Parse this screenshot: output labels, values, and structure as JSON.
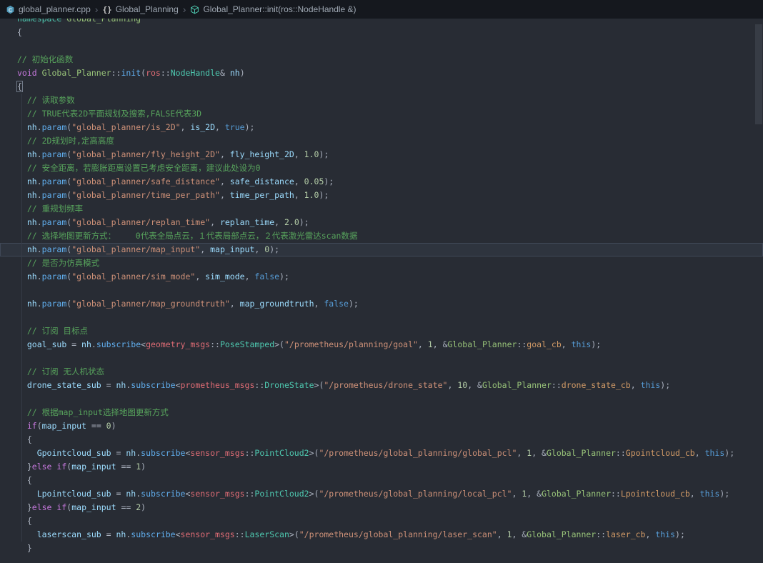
{
  "breadcrumb": {
    "separator": "›",
    "file": "global_planner.cpp",
    "namespace_icon": "{}",
    "namespace": "Global_Planning",
    "symbol": "Global_Planner::init(ros::NodeHandle &)"
  },
  "palette": {
    "editor_background": "#282c34",
    "breadcrumb_background": "#15181e",
    "foreground": "#abb2bf",
    "comment": "#57a35c",
    "keyword": "#c678dd",
    "boolean_this": "#569cd6",
    "function": "#61afef",
    "string": "#ce9178",
    "type": "#4ec9b0",
    "namespace_token": "#e06c75",
    "class_token": "#98c379",
    "number": "#b5cea8",
    "member_callback": "#d19a66",
    "variable": "#9cdcfe"
  },
  "editor": {
    "lines": [
      {
        "t": [
          [
            "ty",
            "namespace"
          ],
          [
            "pl",
            " "
          ],
          [
            "cls",
            "Global_Planning"
          ]
        ]
      },
      {
        "t": [
          [
            "pl",
            "{"
          ]
        ]
      },
      {
        "t": []
      },
      {
        "t": [
          [
            "cm",
            "// 初始化函数"
          ]
        ]
      },
      {
        "t": [
          [
            "kw",
            "void"
          ],
          [
            "pl",
            " "
          ],
          [
            "cls",
            "Global_Planner"
          ],
          [
            "pl",
            "::"
          ],
          [
            "fn",
            "init"
          ],
          [
            "pl",
            "("
          ],
          [
            "ns",
            "ros"
          ],
          [
            "pl",
            "::"
          ],
          [
            "ty",
            "NodeHandle"
          ],
          [
            "pl",
            "& "
          ],
          [
            "id",
            "nh"
          ],
          [
            "pl",
            ")"
          ]
        ]
      },
      {
        "t": [
          [
            "brkt",
            "{"
          ]
        ]
      },
      {
        "t": [
          [
            "cm",
            "  // 读取参数"
          ]
        ]
      },
      {
        "t": [
          [
            "cm",
            "  // TRUE代表2D平面规划及搜索,FALSE代表3D"
          ]
        ]
      },
      {
        "t": [
          [
            "pl",
            "  "
          ],
          [
            "id",
            "nh"
          ],
          [
            "pl",
            "."
          ],
          [
            "fn",
            "param"
          ],
          [
            "pl",
            "("
          ],
          [
            "str",
            "\"global_planner/is_2D\""
          ],
          [
            "pl",
            ", "
          ],
          [
            "id",
            "is_2D"
          ],
          [
            "pl",
            ", "
          ],
          [
            "kw2",
            "true"
          ],
          [
            "pl",
            ");"
          ]
        ]
      },
      {
        "t": [
          [
            "cm",
            "  // 2D规划时,定高高度"
          ]
        ]
      },
      {
        "t": [
          [
            "pl",
            "  "
          ],
          [
            "id",
            "nh"
          ],
          [
            "pl",
            "."
          ],
          [
            "fn",
            "param"
          ],
          [
            "pl",
            "("
          ],
          [
            "str",
            "\"global_planner/fly_height_2D\""
          ],
          [
            "pl",
            ", "
          ],
          [
            "id",
            "fly_height_2D"
          ],
          [
            "pl",
            ", "
          ],
          [
            "num",
            "1.0"
          ],
          [
            "pl",
            ");"
          ]
        ]
      },
      {
        "t": [
          [
            "cm",
            "  // 安全距离，若膨胀距离设置已考虑安全距离，建议此处设为0"
          ]
        ]
      },
      {
        "t": [
          [
            "pl",
            "  "
          ],
          [
            "id",
            "nh"
          ],
          [
            "pl",
            "."
          ],
          [
            "fn",
            "param"
          ],
          [
            "pl",
            "("
          ],
          [
            "str",
            "\"global_planner/safe_distance\""
          ],
          [
            "pl",
            ", "
          ],
          [
            "id",
            "safe_distance"
          ],
          [
            "pl",
            ", "
          ],
          [
            "num",
            "0.05"
          ],
          [
            "pl",
            ");"
          ]
        ]
      },
      {
        "t": [
          [
            "pl",
            "  "
          ],
          [
            "id",
            "nh"
          ],
          [
            "pl",
            "."
          ],
          [
            "fn",
            "param"
          ],
          [
            "pl",
            "("
          ],
          [
            "str",
            "\"global_planner/time_per_path\""
          ],
          [
            "pl",
            ", "
          ],
          [
            "id",
            "time_per_path"
          ],
          [
            "pl",
            ", "
          ],
          [
            "num",
            "1.0"
          ],
          [
            "pl",
            ");"
          ]
        ]
      },
      {
        "t": [
          [
            "cm",
            "  // 重规划频率"
          ]
        ]
      },
      {
        "t": [
          [
            "pl",
            "  "
          ],
          [
            "id",
            "nh"
          ],
          [
            "pl",
            "."
          ],
          [
            "fn",
            "param"
          ],
          [
            "pl",
            "("
          ],
          [
            "str",
            "\"global_planner/replan_time\""
          ],
          [
            "pl",
            ", "
          ],
          [
            "id",
            "replan_time"
          ],
          [
            "pl",
            ", "
          ],
          [
            "num",
            "2.0"
          ],
          [
            "pl",
            ");"
          ]
        ]
      },
      {
        "t": [
          [
            "cm",
            "  // 选择地图更新方式：    0代表全局点云，１代表局部点云，２代表激光雷达scan数据"
          ]
        ]
      },
      {
        "hl": true,
        "t": [
          [
            "pl",
            "  "
          ],
          [
            "id",
            "nh"
          ],
          [
            "pl",
            "."
          ],
          [
            "fn",
            "param"
          ],
          [
            "pl",
            "("
          ],
          [
            "str",
            "\"global_planner/map_input\""
          ],
          [
            "pl",
            ", "
          ],
          [
            "id",
            "map_input"
          ],
          [
            "pl",
            ", "
          ],
          [
            "num",
            "0"
          ],
          [
            "pl",
            ");"
          ]
        ]
      },
      {
        "t": [
          [
            "cm",
            "  // 是否为仿真模式"
          ]
        ]
      },
      {
        "t": [
          [
            "pl",
            "  "
          ],
          [
            "id",
            "nh"
          ],
          [
            "pl",
            "."
          ],
          [
            "fn",
            "param"
          ],
          [
            "pl",
            "("
          ],
          [
            "str",
            "\"global_planner/sim_mode\""
          ],
          [
            "pl",
            ", "
          ],
          [
            "id",
            "sim_mode"
          ],
          [
            "pl",
            ", "
          ],
          [
            "kw2",
            "false"
          ],
          [
            "pl",
            ");"
          ]
        ]
      },
      {
        "t": []
      },
      {
        "t": [
          [
            "pl",
            "  "
          ],
          [
            "id",
            "nh"
          ],
          [
            "pl",
            "."
          ],
          [
            "fn",
            "param"
          ],
          [
            "pl",
            "("
          ],
          [
            "str",
            "\"global_planner/map_groundtruth\""
          ],
          [
            "pl",
            ", "
          ],
          [
            "id",
            "map_groundtruth"
          ],
          [
            "pl",
            ", "
          ],
          [
            "kw2",
            "false"
          ],
          [
            "pl",
            ");"
          ]
        ]
      },
      {
        "t": []
      },
      {
        "t": [
          [
            "cm",
            "  // 订阅 目标点"
          ]
        ]
      },
      {
        "t": [
          [
            "pl",
            "  "
          ],
          [
            "id",
            "goal_sub"
          ],
          [
            "pl",
            " = "
          ],
          [
            "id",
            "nh"
          ],
          [
            "pl",
            "."
          ],
          [
            "fn",
            "subscribe"
          ],
          [
            "pl",
            "<"
          ],
          [
            "ns",
            "geometry_msgs"
          ],
          [
            "pl",
            "::"
          ],
          [
            "ty",
            "PoseStamped"
          ],
          [
            "pl",
            ">("
          ],
          [
            "str",
            "\"/prometheus/planning/goal\""
          ],
          [
            "pl",
            ", "
          ],
          [
            "num",
            "1"
          ],
          [
            "pl",
            ", &"
          ],
          [
            "cls",
            "Global_Planner"
          ],
          [
            "pl",
            "::"
          ],
          [
            "cb",
            "goal_cb"
          ],
          [
            "pl",
            ", "
          ],
          [
            "kw2",
            "this"
          ],
          [
            "pl",
            ");"
          ]
        ]
      },
      {
        "t": []
      },
      {
        "t": [
          [
            "cm",
            "  // 订阅 无人机状态"
          ]
        ]
      },
      {
        "t": [
          [
            "pl",
            "  "
          ],
          [
            "id",
            "drone_state_sub"
          ],
          [
            "pl",
            " = "
          ],
          [
            "id",
            "nh"
          ],
          [
            "pl",
            "."
          ],
          [
            "fn",
            "subscribe"
          ],
          [
            "pl",
            "<"
          ],
          [
            "ns",
            "prometheus_msgs"
          ],
          [
            "pl",
            "::"
          ],
          [
            "ty",
            "DroneState"
          ],
          [
            "pl",
            ">("
          ],
          [
            "str",
            "\"/prometheus/drone_state\""
          ],
          [
            "pl",
            ", "
          ],
          [
            "num",
            "10"
          ],
          [
            "pl",
            ", &"
          ],
          [
            "cls",
            "Global_Planner"
          ],
          [
            "pl",
            "::"
          ],
          [
            "cb",
            "drone_state_cb"
          ],
          [
            "pl",
            ", "
          ],
          [
            "kw2",
            "this"
          ],
          [
            "pl",
            ");"
          ]
        ]
      },
      {
        "t": []
      },
      {
        "t": [
          [
            "cm",
            "  // 根据map_input选择地图更新方式"
          ]
        ]
      },
      {
        "t": [
          [
            "pl",
            "  "
          ],
          [
            "kw",
            "if"
          ],
          [
            "pl",
            "("
          ],
          [
            "id",
            "map_input"
          ],
          [
            "pl",
            " == "
          ],
          [
            "num",
            "0"
          ],
          [
            "pl",
            ")"
          ]
        ]
      },
      {
        "t": [
          [
            "pl",
            "  {"
          ]
        ]
      },
      {
        "t": [
          [
            "pl",
            "    "
          ],
          [
            "id",
            "Gpointcloud_sub"
          ],
          [
            "pl",
            " = "
          ],
          [
            "id",
            "nh"
          ],
          [
            "pl",
            "."
          ],
          [
            "fn",
            "subscribe"
          ],
          [
            "pl",
            "<"
          ],
          [
            "ns",
            "sensor_msgs"
          ],
          [
            "pl",
            "::"
          ],
          [
            "ty",
            "PointCloud2"
          ],
          [
            "pl",
            ">("
          ],
          [
            "str",
            "\"/prometheus/global_planning/global_pcl\""
          ],
          [
            "pl",
            ", "
          ],
          [
            "num",
            "1"
          ],
          [
            "pl",
            ", &"
          ],
          [
            "cls",
            "Global_Planner"
          ],
          [
            "pl",
            "::"
          ],
          [
            "cb",
            "Gpointcloud_cb"
          ],
          [
            "pl",
            ", "
          ],
          [
            "kw2",
            "this"
          ],
          [
            "pl",
            ");"
          ]
        ]
      },
      {
        "t": [
          [
            "pl",
            "  }"
          ],
          [
            "kw",
            "else"
          ],
          [
            "pl",
            " "
          ],
          [
            "kw",
            "if"
          ],
          [
            "pl",
            "("
          ],
          [
            "id",
            "map_input"
          ],
          [
            "pl",
            " == "
          ],
          [
            "num",
            "1"
          ],
          [
            "pl",
            ")"
          ]
        ]
      },
      {
        "t": [
          [
            "pl",
            "  {"
          ]
        ]
      },
      {
        "t": [
          [
            "pl",
            "    "
          ],
          [
            "id",
            "Lpointcloud_sub"
          ],
          [
            "pl",
            " = "
          ],
          [
            "id",
            "nh"
          ],
          [
            "pl",
            "."
          ],
          [
            "fn",
            "subscribe"
          ],
          [
            "pl",
            "<"
          ],
          [
            "ns",
            "sensor_msgs"
          ],
          [
            "pl",
            "::"
          ],
          [
            "ty",
            "PointCloud2"
          ],
          [
            "pl",
            ">("
          ],
          [
            "str",
            "\"/prometheus/global_planning/local_pcl\""
          ],
          [
            "pl",
            ", "
          ],
          [
            "num",
            "1"
          ],
          [
            "pl",
            ", &"
          ],
          [
            "cls",
            "Global_Planner"
          ],
          [
            "pl",
            "::"
          ],
          [
            "cb",
            "Lpointcloud_cb"
          ],
          [
            "pl",
            ", "
          ],
          [
            "kw2",
            "this"
          ],
          [
            "pl",
            ");"
          ]
        ]
      },
      {
        "t": [
          [
            "pl",
            "  }"
          ],
          [
            "kw",
            "else"
          ],
          [
            "pl",
            " "
          ],
          [
            "kw",
            "if"
          ],
          [
            "pl",
            "("
          ],
          [
            "id",
            "map_input"
          ],
          [
            "pl",
            " == "
          ],
          [
            "num",
            "2"
          ],
          [
            "pl",
            ")"
          ]
        ]
      },
      {
        "t": [
          [
            "pl",
            "  {"
          ]
        ]
      },
      {
        "t": [
          [
            "pl",
            "    "
          ],
          [
            "id",
            "laserscan_sub"
          ],
          [
            "pl",
            " = "
          ],
          [
            "id",
            "nh"
          ],
          [
            "pl",
            "."
          ],
          [
            "fn",
            "subscribe"
          ],
          [
            "pl",
            "<"
          ],
          [
            "ns",
            "sensor_msgs"
          ],
          [
            "pl",
            "::"
          ],
          [
            "ty",
            "LaserScan"
          ],
          [
            "pl",
            ">("
          ],
          [
            "str",
            "\"/prometheus/global_planning/laser_scan\""
          ],
          [
            "pl",
            ", "
          ],
          [
            "num",
            "1"
          ],
          [
            "pl",
            ", &"
          ],
          [
            "cls",
            "Global_Planner"
          ],
          [
            "pl",
            "::"
          ],
          [
            "cb",
            "laser_cb"
          ],
          [
            "pl",
            ", "
          ],
          [
            "kw2",
            "this"
          ],
          [
            "pl",
            ");"
          ]
        ]
      },
      {
        "t": [
          [
            "pl",
            "  }"
          ]
        ]
      }
    ]
  }
}
